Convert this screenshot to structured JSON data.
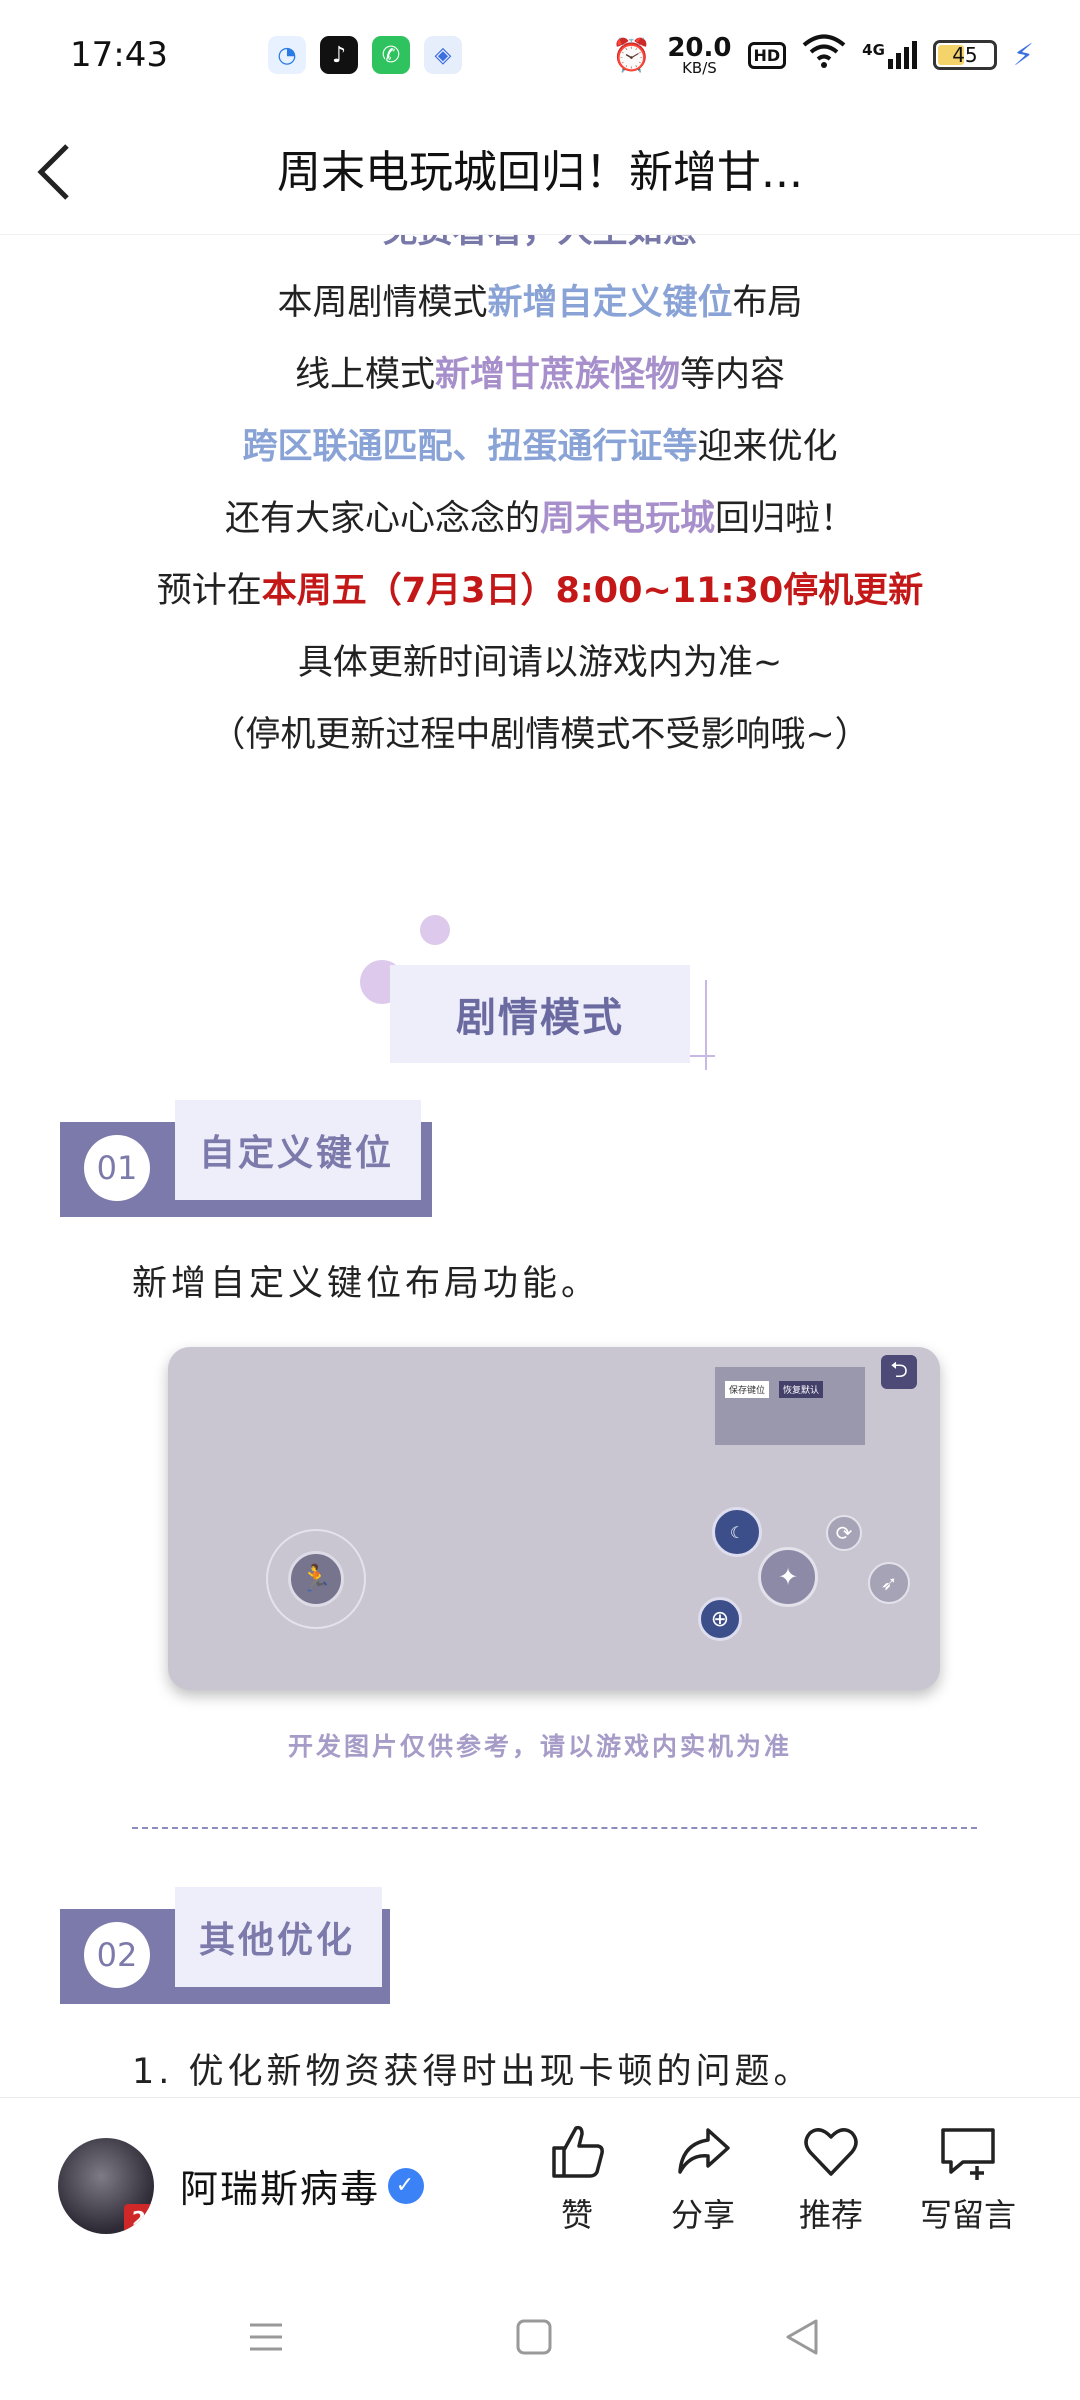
{
  "status_bar": {
    "time": "17:43",
    "speed_value": "20.0",
    "speed_unit": "KB/S",
    "hd": "HD",
    "network": "4G",
    "battery": "45",
    "battery_level": 0.45,
    "apps": [
      "browser-icon",
      "tiktok-icon",
      "phone-icon",
      "compass-icon"
    ]
  },
  "header": {
    "back_icon": "chevron-left-icon",
    "title": "周末电玩城回归！新增甘..."
  },
  "intro": {
    "line0": "免费看看，人生如意",
    "line1": {
      "pre": "本周剧情模式",
      "hl": "新增自定义键位",
      "post": "布局"
    },
    "line2": {
      "pre": "线上模式",
      "hl": "新增甘蔗族怪物",
      "post": "等内容"
    },
    "line3": {
      "hl": "跨区联通匹配、扭蛋通行证等",
      "post": "迎来优化"
    },
    "line4": {
      "pre": "还有大家心心念念的",
      "hl": "周末电玩城",
      "post": "回归啦！"
    },
    "line5": {
      "pre": "预计在",
      "hl": "本周五（7月3日）8:00~11:30停机更新"
    },
    "line6": "具体更新时间请以游戏内为准~",
    "line7": "（停机更新过程中剧情模式不受影响哦~）"
  },
  "section": {
    "title": "剧情模式"
  },
  "subsections": [
    {
      "num": "01",
      "label": "自定义键位",
      "text": "新增自定义键位布局功能。"
    },
    {
      "num": "02",
      "label": "其他优化",
      "text": "1. 优化新物资获得时出现卡顿的问题。"
    }
  ],
  "screenshot": {
    "save_label": "保存键位",
    "reset_label": "恢复默认",
    "caption": "开发图片仅供参考，请以游戏内实机为准"
  },
  "footer": {
    "author": "阿瑞斯病毒",
    "avatar_badge": "2",
    "actions": [
      {
        "icon": "thumbs-up-icon",
        "label": "赞"
      },
      {
        "icon": "share-icon",
        "label": "分享"
      },
      {
        "icon": "heart-icon",
        "label": "推荐"
      },
      {
        "icon": "comment-add-icon",
        "label": "写留言"
      }
    ]
  },
  "colors": {
    "accent_blue": "#8aa3d6",
    "accent_purple": "#a78fcb",
    "accent_red": "#c41818",
    "section_bg": "#eeeefb",
    "section_bar": "#7c7aaa"
  }
}
